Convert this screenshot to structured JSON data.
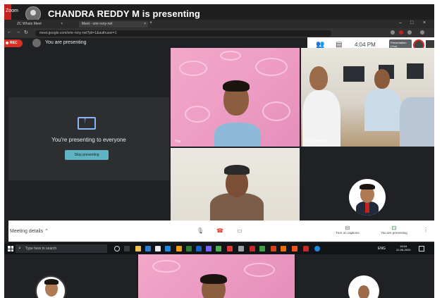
{
  "banner": {
    "title": "CHANDRA REDDY M is presenting",
    "rec_tab": "Zoom"
  },
  "browser": {
    "tabs": [
      {
        "label": "ZC Whats Meet"
      },
      {
        "label": "Meet - xmr-rsny-rwt"
      }
    ],
    "url": "meet.google.com/xmr-rsny-rwt?pli=1&authuser=1"
  },
  "meet": {
    "rec_label": "REC",
    "you_presenting": "You are presenting",
    "time": "4:04 PM",
    "presentation_chip": "Presentation (You)"
  },
  "present_card": {
    "message": "You're presenting to everyone",
    "stop_label": "Stop presenting"
  },
  "tiles": [
    {
      "name": "You"
    },
    {
      "name": "A.R. Thejaswi"
    }
  ],
  "bottom": {
    "meeting_details": "Meeting details",
    "captions": "Turn on captions",
    "presenting": "You are presenting"
  },
  "taskbar": {
    "search_placeholder": "Type here to search",
    "clock_time": "16:04",
    "clock_date": "22-06-2020",
    "lang": "ENG"
  },
  "colors": {
    "meet_bg": "#202124",
    "rec_red": "#d93025",
    "stop_button": "#5fb3c2",
    "pink_wall": "#ee9fc4"
  }
}
